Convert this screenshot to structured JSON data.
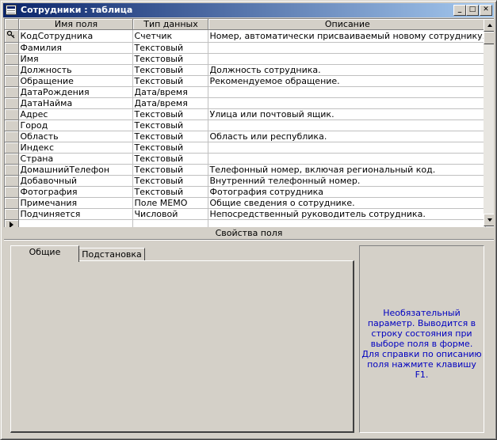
{
  "window": {
    "title": "Сотрудники : таблица",
    "controls": {
      "minimize": "_",
      "maximize": "□",
      "close": "✕"
    }
  },
  "grid": {
    "columns": [
      "Имя поля",
      "Тип данных",
      "Описание"
    ],
    "rows": [
      {
        "name": "КодСотрудника",
        "type": "Счетчик",
        "desc": "Номер, автоматически присваиваемый новому сотруднику.",
        "key": true
      },
      {
        "name": "Фамилия",
        "type": "Текстовый",
        "desc": ""
      },
      {
        "name": "Имя",
        "type": "Текстовый",
        "desc": ""
      },
      {
        "name": "Должность",
        "type": "Текстовый",
        "desc": "Должность сотрудника."
      },
      {
        "name": "Обращение",
        "type": "Текстовый",
        "desc": "Рекомендуемое обращение."
      },
      {
        "name": "ДатаРождения",
        "type": "Дата/время",
        "desc": ""
      },
      {
        "name": "ДатаНайма",
        "type": "Дата/время",
        "desc": ""
      },
      {
        "name": "Адрес",
        "type": "Текстовый",
        "desc": "Улица или почтовый ящик."
      },
      {
        "name": "Город",
        "type": "Текстовый",
        "desc": ""
      },
      {
        "name": "Область",
        "type": "Текстовый",
        "desc": "Область или республика."
      },
      {
        "name": "Индекс",
        "type": "Текстовый",
        "desc": ""
      },
      {
        "name": "Страна",
        "type": "Текстовый",
        "desc": ""
      },
      {
        "name": "ДомашнийТелефон",
        "type": "Текстовый",
        "desc": "Телефонный номер, включая региональный код."
      },
      {
        "name": "Добавочный",
        "type": "Текстовый",
        "desc": "Внутренний телефонный номер."
      },
      {
        "name": "Фотография",
        "type": "Текстовый",
        "desc": "Фотография сотрудника"
      },
      {
        "name": "Примечания",
        "type": "Поле MEMO",
        "desc": "Общие сведения о сотруднике."
      },
      {
        "name": "Подчиняется",
        "type": "Числовой",
        "desc": "Непосредственный руководитель сотрудника."
      },
      {
        "name": "",
        "type": "",
        "desc": "",
        "current": true
      }
    ]
  },
  "properties": {
    "label": "Свойства поля",
    "tabs": [
      "Общие",
      "Подстановка"
    ],
    "hint": "Необязательный параметр. Выводится в строку состояния при выборе поля в форме.  Для справки по описанию поля нажмите клавишу F1."
  },
  "icons": {
    "key": "key-icon",
    "current_row": "current-row-arrow-icon",
    "table": "table-icon"
  },
  "colors": {
    "title_start": "#0a246a",
    "title_end": "#a6caf0",
    "hint_text": "#0000c0",
    "face": "#d4d0c8"
  }
}
